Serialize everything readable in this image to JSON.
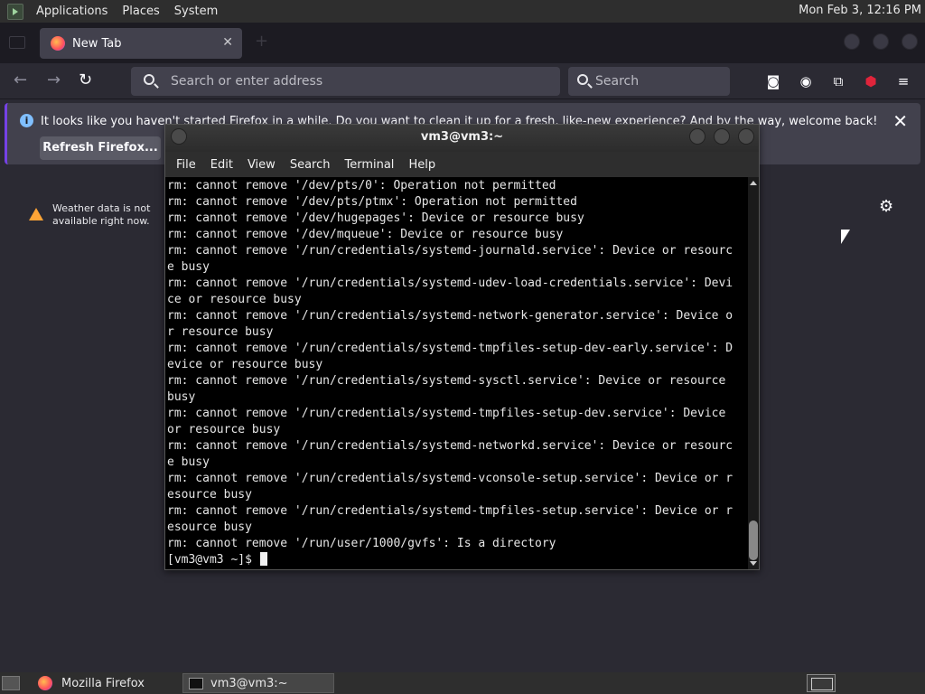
{
  "top_panel": {
    "menus": [
      "Applications",
      "Places",
      "System"
    ],
    "clock": "Mon Feb  3, 12:16 PM"
  },
  "firefox": {
    "tab_title": "New Tab",
    "url_placeholder": "Search or enter address",
    "search_placeholder": "Search",
    "notice": {
      "message": "It looks like you haven't started Firefox in a while. Do you want to clean it up for a fresh, like-new experience? And by the way, welcome back!",
      "refresh_button": "Refresh Firefox..."
    },
    "weather_message": "Weather data is not available right now."
  },
  "terminal": {
    "title": "vm3@vm3:~",
    "menu": [
      "File",
      "Edit",
      "View",
      "Search",
      "Terminal",
      "Help"
    ],
    "lines": [
      "rm: cannot remove '/dev/pts/0': Operation not permitted",
      "rm: cannot remove '/dev/pts/ptmx': Operation not permitted",
      "rm: cannot remove '/dev/hugepages': Device or resource busy",
      "rm: cannot remove '/dev/mqueue': Device or resource busy",
      "rm: cannot remove '/run/credentials/systemd-journald.service': Device or resourc",
      "e busy",
      "rm: cannot remove '/run/credentials/systemd-udev-load-credentials.service': Devi",
      "ce or resource busy",
      "rm: cannot remove '/run/credentials/systemd-network-generator.service': Device o",
      "r resource busy",
      "rm: cannot remove '/run/credentials/systemd-tmpfiles-setup-dev-early.service': D",
      "evice or resource busy",
      "rm: cannot remove '/run/credentials/systemd-sysctl.service': Device or resource",
      "busy",
      "rm: cannot remove '/run/credentials/systemd-tmpfiles-setup-dev.service': Device",
      "or resource busy",
      "rm: cannot remove '/run/credentials/systemd-networkd.service': Device or resourc",
      "e busy",
      "rm: cannot remove '/run/credentials/systemd-vconsole-setup.service': Device or r",
      "esource busy",
      "rm: cannot remove '/run/credentials/systemd-tmpfiles-setup.service': Device or r",
      "esource busy",
      "rm: cannot remove '/run/user/1000/gvfs': Is a directory"
    ],
    "prompt": "[vm3@vm3 ~]$ "
  },
  "taskbar": {
    "items": [
      "Mozilla Firefox",
      "vm3@vm3:~"
    ]
  }
}
